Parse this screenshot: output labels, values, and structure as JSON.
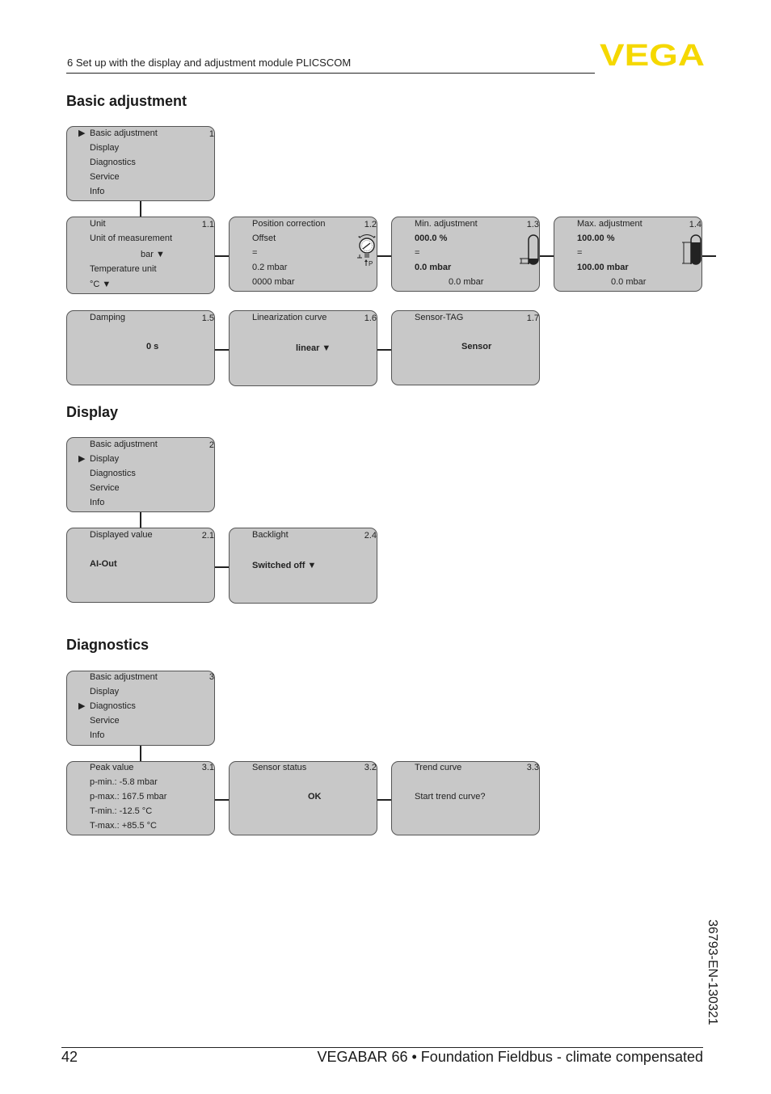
{
  "header": {
    "chapter": "6 Set up with the display and adjustment module PLICSCOM",
    "logo_text": "VEGA",
    "logo_color": "#f5d800"
  },
  "sections": {
    "basic": {
      "title": "Basic adjustment",
      "main_menu": {
        "items": [
          "Basic adjustment",
          "Display",
          "Diagnostics",
          "Service",
          "Info"
        ],
        "selected_index": 0,
        "number": "1"
      },
      "screens": [
        {
          "title": "Unit",
          "number": "1.1",
          "lines": [
            "Unit of measurement",
            "bar ▼",
            "Temperature unit",
            "°C ▼"
          ]
        },
        {
          "title": "Position correction",
          "number": "1.2",
          "lines": [
            "Offset",
            "=",
            "0.2 mbar",
            "0000 mbar"
          ],
          "icon": "pressure-gauge-icon"
        },
        {
          "title": "Min. adjustment",
          "number": "1.3",
          "lines": [
            "000.0 %",
            "=",
            "0.0 mbar",
            "0.0 mbar"
          ],
          "icon": "tank-min-icon"
        },
        {
          "title": "Max. adjustment",
          "number": "1.4",
          "lines": [
            "100.00 %",
            "=",
            "100.00 mbar",
            "0.0 mbar"
          ],
          "icon": "tank-max-icon"
        },
        {
          "title": "Damping",
          "number": "1.5",
          "value": "0 s"
        },
        {
          "title": "Linearization curve",
          "number": "1.6",
          "value": "linear ▼"
        },
        {
          "title": "Sensor-TAG",
          "number": "1.7",
          "value": "Sensor"
        }
      ]
    },
    "display": {
      "title": "Display",
      "main_menu": {
        "items": [
          "Basic adjustment",
          "Display",
          "Diagnostics",
          "Service",
          "Info"
        ],
        "selected_index": 1,
        "number": "2"
      },
      "screens": [
        {
          "title": "Displayed value",
          "number": "2.1",
          "value": "AI-Out"
        },
        {
          "title": "Backlight",
          "number": "2.4",
          "value": "Switched off ▼"
        }
      ]
    },
    "diagnostics": {
      "title": "Diagnostics",
      "main_menu": {
        "items": [
          "Basic adjustment",
          "Display",
          "Diagnostics",
          "Service",
          "Info"
        ],
        "selected_index": 2,
        "number": "3"
      },
      "screens": [
        {
          "title": "Peak value",
          "number": "3.1",
          "lines": [
            "p-min.: -5.8 mbar",
            "p-max.: 167.5 mbar",
            "T-min.: -12.5 °C",
            "T-max.: +85.5 °C"
          ]
        },
        {
          "title": "Sensor status",
          "number": "3.2",
          "value": "OK"
        },
        {
          "title": "Trend curve",
          "number": "3.3",
          "value": "Start trend curve?"
        }
      ]
    }
  },
  "footer": {
    "page_number": "42",
    "product": "VEGABAR 66 • Foundation Fieldbus - climate compensated",
    "doc_id": "36793-EN-130321"
  },
  "icons": {
    "selected_marker": "▶"
  }
}
